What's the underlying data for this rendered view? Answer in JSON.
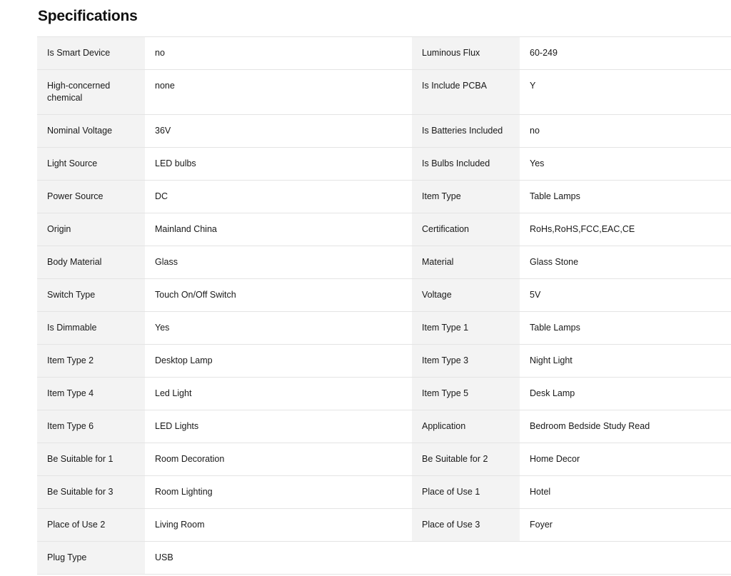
{
  "title": "Specifications",
  "rows": [
    {
      "k1": "Is Smart Device",
      "v1": "no",
      "k2": "Luminous Flux",
      "v2": "60-249"
    },
    {
      "k1": "High-concerned chemical",
      "v1": "none",
      "k2": "Is Include PCBA",
      "v2": "Y"
    },
    {
      "k1": "Nominal Voltage",
      "v1": "36V",
      "k2": "Is Batteries Included",
      "v2": "no"
    },
    {
      "k1": "Light Source",
      "v1": "LED bulbs",
      "k2": "Is Bulbs Included",
      "v2": "Yes"
    },
    {
      "k1": "Power Source",
      "v1": "DC",
      "k2": "Item Type",
      "v2": "Table Lamps"
    },
    {
      "k1": "Origin",
      "v1": "Mainland China",
      "k2": "Certification",
      "v2": "RoHs,RoHS,FCC,EAC,CE"
    },
    {
      "k1": "Body Material",
      "v1": "Glass",
      "k2": "Material",
      "v2": "Glass Stone"
    },
    {
      "k1": "Switch Type",
      "v1": "Touch On/Off Switch",
      "k2": "Voltage",
      "v2": "5V"
    },
    {
      "k1": "Is Dimmable",
      "v1": "Yes",
      "k2": "Item Type 1",
      "v2": "Table Lamps"
    },
    {
      "k1": "Item Type 2",
      "v1": "Desktop Lamp",
      "k2": "Item Type 3",
      "v2": "Night Light"
    },
    {
      "k1": "Item Type 4",
      "v1": "Led Light",
      "k2": "Item Type 5",
      "v2": "Desk Lamp"
    },
    {
      "k1": "Item Type 6",
      "v1": "LED Lights",
      "k2": "Application",
      "v2": "Bedroom Bedside Study Read"
    },
    {
      "k1": "Be Suitable for 1",
      "v1": "Room Decoration",
      "k2": "Be Suitable for 2",
      "v2": "Home Decor"
    },
    {
      "k1": "Be Suitable for 3",
      "v1": "Room Lighting",
      "k2": "Place of Use 1",
      "v2": "Hotel"
    },
    {
      "k1": "Place of Use 2",
      "v1": "Living Room",
      "k2": "Place of Use 3",
      "v2": "Foyer"
    },
    {
      "k1": "Plug Type",
      "v1": "USB",
      "k2": "",
      "v2": ""
    }
  ]
}
